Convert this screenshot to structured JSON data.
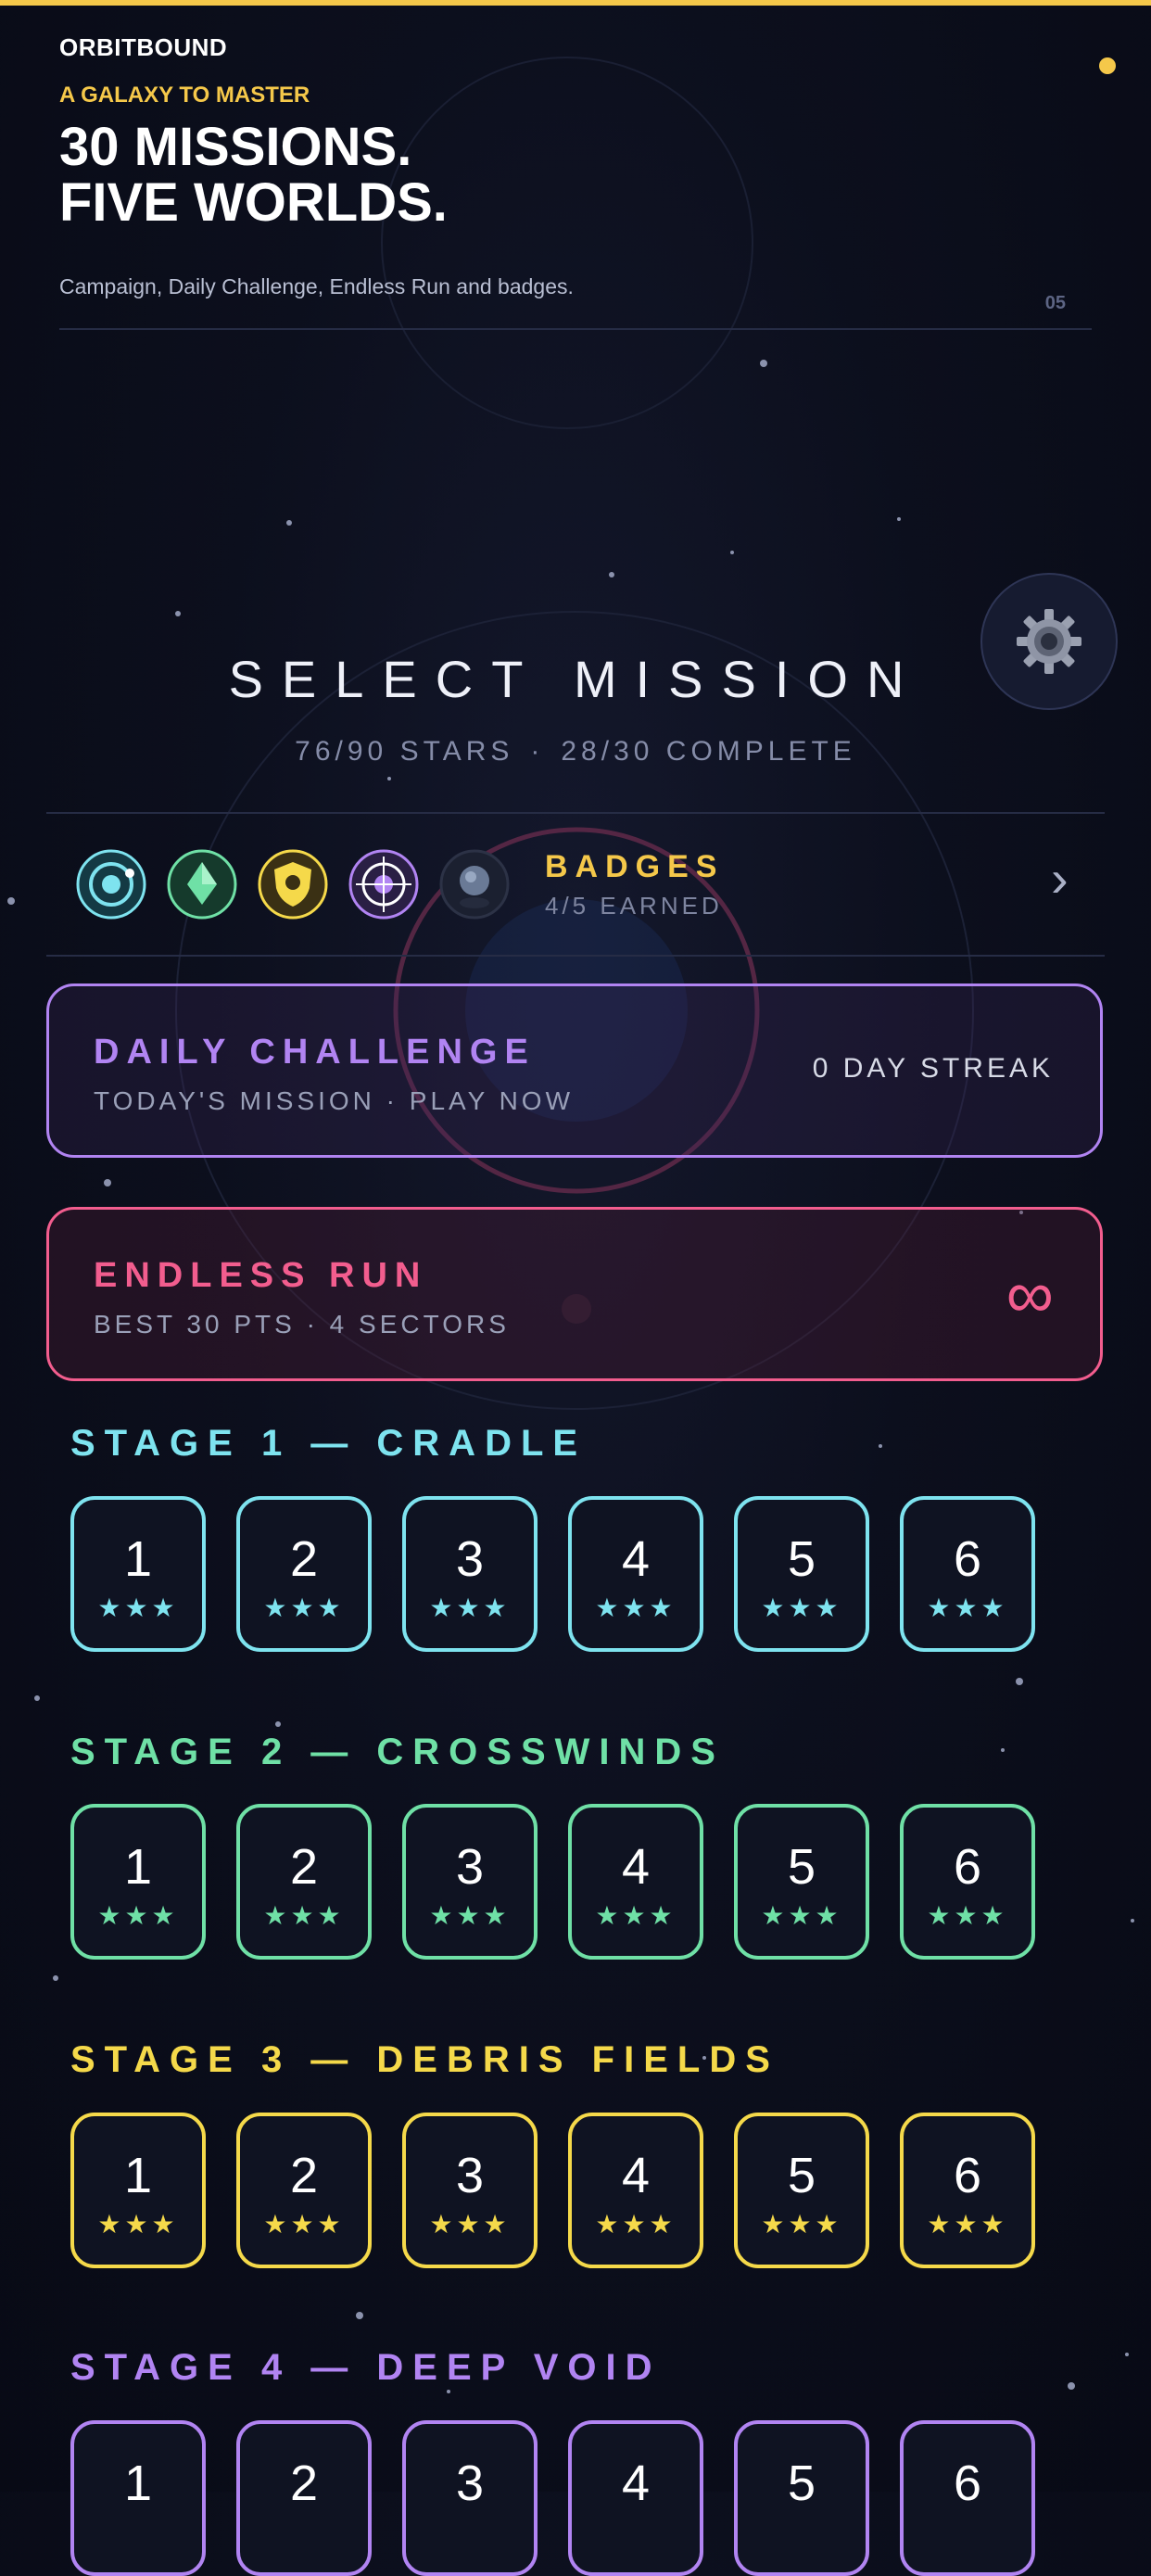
{
  "header": {
    "brand": "ORBITBOUND",
    "tagline": "A GALAXY TO MASTER",
    "headline_line1": "30 MISSIONS.",
    "headline_line2": "FIVE WORLDS.",
    "description": "Campaign, Daily Challenge, Endless Run and badges.",
    "page_number": "05"
  },
  "main": {
    "title": "SELECT MISSION",
    "stars_stat": "76/90 STARS",
    "stat_separator": "·",
    "complete_stat": "28/30 COMPLETE"
  },
  "badges": {
    "title": "BADGES",
    "count": "4/5 EARNED",
    "chevron": "›",
    "icons": [
      "orbit-badge-icon",
      "crystal-badge-icon",
      "shield-badge-icon",
      "target-badge-icon",
      "planet-badge-icon-locked"
    ]
  },
  "daily_challenge": {
    "title": "DAILY CHALLENGE",
    "subtitle": "TODAY'S MISSION · PLAY NOW",
    "streak": "0 DAY STREAK"
  },
  "endless_run": {
    "title": "ENDLESS RUN",
    "subtitle": "BEST 30 PTS · 4 SECTORS",
    "symbol": "∞"
  },
  "stages": [
    {
      "title": "STAGE 1 — CRADLE",
      "color": "#7ee3ef",
      "missions": [
        {
          "number": "1",
          "stars": "★★★"
        },
        {
          "number": "2",
          "stars": "★★★"
        },
        {
          "number": "3",
          "stars": "★★★"
        },
        {
          "number": "4",
          "stars": "★★★"
        },
        {
          "number": "5",
          "stars": "★★★"
        },
        {
          "number": "6",
          "stars": "★★★"
        }
      ]
    },
    {
      "title": "STAGE 2 — CROSSWINDS",
      "color": "#6fe0a6",
      "missions": [
        {
          "number": "1",
          "stars": "★★★"
        },
        {
          "number": "2",
          "stars": "★★★"
        },
        {
          "number": "3",
          "stars": "★★★"
        },
        {
          "number": "4",
          "stars": "★★★"
        },
        {
          "number": "5",
          "stars": "★★★"
        },
        {
          "number": "6",
          "stars": "★★★"
        }
      ]
    },
    {
      "title": "STAGE 3 — DEBRIS FIELDS",
      "color": "#f5d94a",
      "missions": [
        {
          "number": "1",
          "stars": "★★★"
        },
        {
          "number": "2",
          "stars": "★★★"
        },
        {
          "number": "3",
          "stars": "★★★"
        },
        {
          "number": "4",
          "stars": "★★★"
        },
        {
          "number": "5",
          "stars": "★★★"
        },
        {
          "number": "6",
          "stars": "★★★"
        }
      ]
    },
    {
      "title": "STAGE 4 — DEEP VOID",
      "color": "#b184f2",
      "missions": [
        {
          "number": "1",
          "stars": ""
        },
        {
          "number": "2",
          "stars": ""
        },
        {
          "number": "3",
          "stars": ""
        },
        {
          "number": "4",
          "stars": ""
        },
        {
          "number": "5",
          "stars": ""
        },
        {
          "number": "6",
          "stars": ""
        }
      ]
    }
  ],
  "colors": {
    "accent": "#f5c84a",
    "daily": "#b184f2",
    "endless": "#f25d8e",
    "background": "#0c0f1d"
  }
}
